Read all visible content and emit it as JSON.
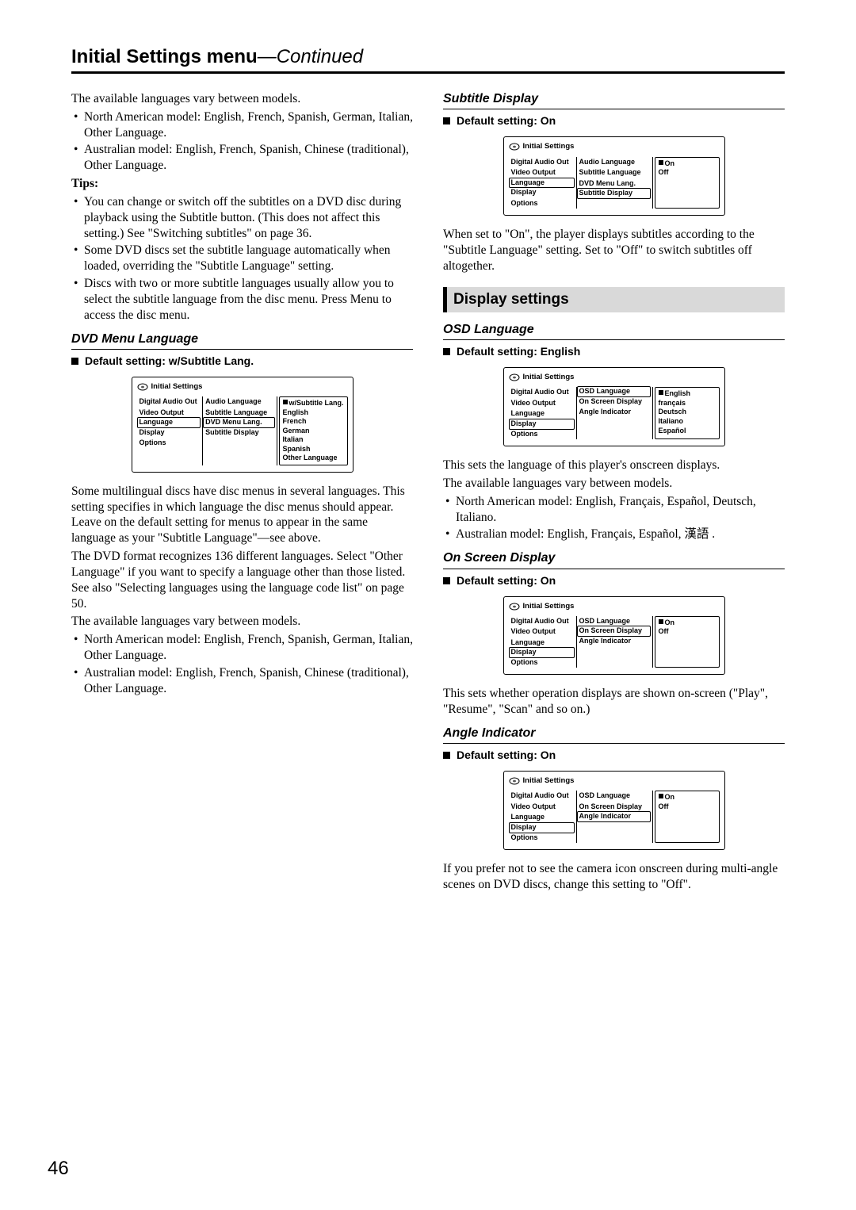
{
  "header": {
    "title": "Initial Settings menu",
    "cont": "—Continued"
  },
  "pageNumber": "46",
  "left": {
    "intro": "The available languages vary between models.",
    "models": [
      "North American model: English, French, Spanish, German, Italian, Other Language.",
      "Australian model: English, French, Spanish, Chinese (traditional), Other Language."
    ],
    "tipsLabel": "Tips:",
    "tips": [
      "You can change or switch off the subtitles on a DVD disc during playback using the Subtitle button. (This does not affect this setting.) See \"Switching subtitles\" on page 36.",
      "Some DVD discs set the subtitle language automatically when loaded, overriding the \"Subtitle Language\" setting.",
      "Discs with two or more subtitle languages usually allow you to select the subtitle language from the disc menu. Press Menu to access the disc menu."
    ],
    "dvdMenuHeading": "DVD Menu Language",
    "dvdMenuDefault": "Default setting: w/Subtitle Lang.",
    "osd1": {
      "title": "Initial Settings",
      "nav": [
        "Digital Audio Out",
        "Video Output",
        "Language",
        "Display",
        "Options"
      ],
      "navBoxed": "Language",
      "mid": [
        "Audio Language",
        "Subtitle Language",
        "DVD Menu Lang.",
        "Subtitle Display"
      ],
      "midBoxed": "DVD Menu Lang.",
      "opts": [
        "w/Subtitle Lang.",
        "English",
        "French",
        "German",
        "Italian",
        "Spanish",
        "Other Language"
      ],
      "selected": "w/Subtitle Lang."
    },
    "para1": "Some multilingual discs have disc menus in several languages. This setting specifies in which language the disc menus should appear. Leave on the default setting for menus to appear in the same language as your \"Subtitle Language\"—see above.",
    "para2": "The DVD format recognizes 136 different languages. Select \"Other Language\" if you want to specify a language other than those listed. See also \"Selecting languages using the language code list\" on page 50.",
    "para3": "The available languages vary between models.",
    "models2": [
      "North American model: English, French, Spanish, German, Italian, Other Language.",
      "Australian model: English, French, Spanish, Chinese (traditional), Other Language."
    ]
  },
  "right": {
    "subtitleHeading": "Subtitle Display",
    "subtitleDefault": "Default setting: On",
    "osd2": {
      "title": "Initial Settings",
      "nav": [
        "Digital Audio Out",
        "Video Output",
        "Language",
        "Display",
        "Options"
      ],
      "navBoxed": "Language",
      "mid": [
        "Audio Language",
        "Subtitle Language",
        "DVD Menu Lang.",
        "Subtitle Display"
      ],
      "midBoxed": "Subtitle Display",
      "opts": [
        "On",
        "Off"
      ],
      "selected": "On"
    },
    "subtitlePara": "When set to \"On\", the player displays subtitles according to the \"Subtitle Language\" setting. Set to \"Off\" to switch subtitles off altogether.",
    "sectionBar": "Display settings",
    "osdLangHeading": "OSD Language",
    "osdLangDefault": "Default setting: English",
    "osd3": {
      "title": "Initial Settings",
      "nav": [
        "Digital Audio Out",
        "Video Output",
        "Language",
        "Display",
        "Options"
      ],
      "navBoxed": "Display",
      "mid": [
        "OSD Language",
        "On Screen Display",
        "Angle Indicator"
      ],
      "midBoxed": "OSD Language",
      "opts": [
        "English",
        "français",
        "Deutsch",
        "Italiano",
        "Español"
      ],
      "selected": "English"
    },
    "osdLangPara1": "This sets the language of this player's onscreen displays.",
    "osdLangPara2": "The available languages vary between models.",
    "osdLangModels": [
      "North American model: English, Français, Español, Deutsch, Italiano.",
      "Australian model: English, Français, Español, 漢語 ."
    ],
    "onScreenHeading": "On Screen Display",
    "onScreenDefault": "Default setting: On",
    "osd4": {
      "title": "Initial Settings",
      "nav": [
        "Digital Audio Out",
        "Video Output",
        "Language",
        "Display",
        "Options"
      ],
      "navBoxed": "Display",
      "mid": [
        "OSD Language",
        "On Screen Display",
        "Angle Indicator"
      ],
      "midBoxed": "On Screen Display",
      "opts": [
        "On",
        "Off"
      ],
      "selected": "On"
    },
    "onScreenPara": "This sets whether operation displays are shown on-screen (\"Play\", \"Resume\", \"Scan\" and so on.)",
    "angleHeading": "Angle Indicator",
    "angleDefault": "Default setting: On",
    "osd5": {
      "title": "Initial Settings",
      "nav": [
        "Digital Audio Out",
        "Video Output",
        "Language",
        "Display",
        "Options"
      ],
      "navBoxed": "Display",
      "mid": [
        "OSD Language",
        "On Screen Display",
        "Angle Indicator"
      ],
      "midBoxed": "Angle Indicator",
      "opts": [
        "On",
        "Off"
      ],
      "selected": "On"
    },
    "anglePara": "If you prefer not to see the camera icon onscreen during multi-angle scenes on DVD discs, change this setting to \"Off\"."
  }
}
